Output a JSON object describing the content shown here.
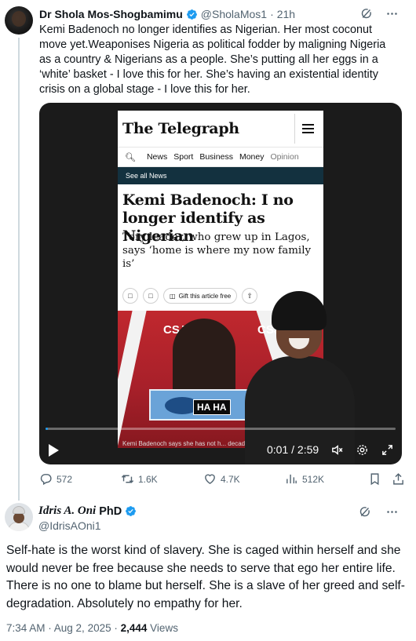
{
  "tweet1": {
    "author_name": "Dr Shola Mos-Shogbamimu",
    "handle": "@SholaMos1",
    "separator": "·",
    "time": "21h",
    "text": "Kemi Badenoch no longer identifies as Nigerian. Her most coconut move yet.Weaponises Nigeria as political fodder by maligning Nigeria as a country & Nigerians as a people. She’s putting all her eggs in a ‘white’ basket - I love this for her. She’s having an existential identity crisis on a global stage - I love this for her.",
    "video": {
      "article": {
        "logo": "The Telegraph",
        "nav_items": [
          "News",
          "Sport",
          "Business",
          "Money",
          "Opinion"
        ],
        "see_all": "See all News",
        "headline": "Kemi Badenoch: I no longer identify as Nigerian",
        "subheadline": "Tory leader, who grew up in Lagos, says ‘home is where my now family is’",
        "gift_label": "Gift this article free",
        "photo_caption": "Kemi Badenoch says she has not h... decades. Credit: Dan Kitwood/Get..."
      },
      "overlay_text": "HA HA",
      "time_current": "0:01",
      "time_separator": "/",
      "time_total": "2:59",
      "progress_fraction": 0.006
    },
    "actions": {
      "replies": "572",
      "reposts": "1.6K",
      "likes": "4.7K",
      "views": "512K"
    }
  },
  "tweet2": {
    "author_name": "Idris A. Oni",
    "author_suffix": "PhD",
    "handle": "@IdrisAOni1",
    "text": "Self-hate is the worst kind of slavery. She is caged within herself and she would never be free because she needs to serve that ego her entire life. There is no one to blame but herself. She is a slave of her greed and self-degradation. Absolutely no empathy for her.",
    "timestamp": "7:34 AM · Aug 2, 2025 ·",
    "views_count": "2,444",
    "views_label": "Views"
  },
  "colors": {
    "accent": "#1d9bf0",
    "text_primary": "#0f1419",
    "text_secondary": "#536471",
    "telegraph_bar": "#13313f"
  },
  "icons": [
    "grok-icon",
    "more-icon",
    "verified-badge-icon",
    "reply-icon",
    "repost-icon",
    "like-icon",
    "views-icon",
    "bookmark-icon",
    "share-icon",
    "play-icon",
    "volume-icon",
    "settings-icon",
    "fullscreen-icon"
  ]
}
